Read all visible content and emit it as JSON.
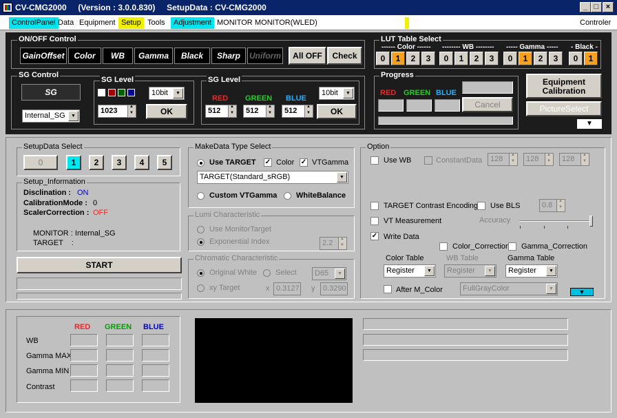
{
  "window": {
    "title": "CV-CMG2000     (Version : 3.0.0.830)     SetupData : CV-CMG2000"
  },
  "menu": {
    "items": [
      "ControlPanel",
      "Data",
      "Equipment",
      "Setup",
      "Tools",
      "Adjustment"
    ],
    "monitor_label": "MONITOR",
    "monitor_value": "MONITOR(WLED)",
    "controller": "Controler"
  },
  "onoff": {
    "title": "ON/OFF Control",
    "buttons": [
      "GainOffset",
      "Color",
      "WB",
      "Gamma",
      "Black",
      "Sharp",
      "Uniform"
    ],
    "all_off": "All OFF",
    "check": "Check"
  },
  "lut": {
    "title": "LUT Table Select",
    "color_hdr": "------ Color ------",
    "wb_hdr": "-------- WB --------",
    "gamma_hdr": "----- Gamma -----",
    "black_hdr": "- Black -",
    "color": [
      "0",
      "1",
      "2",
      "3"
    ],
    "wb": [
      "0",
      "1",
      "2",
      "3"
    ],
    "gamma": [
      "0",
      "1",
      "2",
      "3"
    ],
    "black": [
      "0",
      "1"
    ]
  },
  "sg": {
    "title": "SG Control",
    "button": "SG",
    "source": "Internal_SG",
    "level1": {
      "title": "SG Level",
      "bits": "10bit",
      "value": "1023",
      "ok": "OK"
    },
    "level2": {
      "title": "SG Level",
      "red": "RED",
      "green": "GREEN",
      "blue": "BLUE",
      "r": "512",
      "g": "512",
      "b": "512",
      "bits": "10bit",
      "ok": "OK"
    }
  },
  "progress": {
    "title": "Progress",
    "red": "RED",
    "green": "GREEN",
    "blue": "BLUE",
    "cancel": "Cancel"
  },
  "equip": {
    "calibration": "Equipment Calibration",
    "picture": "PictureSelect"
  },
  "setup_select": {
    "title": "SetupData Select",
    "buttons": [
      "0",
      "1",
      "2",
      "3",
      "4",
      "5"
    ]
  },
  "setup_info": {
    "title": "Setup_Information",
    "disc_label": "Disclination :",
    "disc_val": "ON",
    "cal_label": "CalibrationMode :",
    "cal_val": "0",
    "scaler_label": "ScalerCorrection :",
    "scaler_val": "OFF",
    "monitor_line": "MONITOR : Internal_SG",
    "target_line": "TARGET    :"
  },
  "start": "START",
  "makedata": {
    "title": "MakeData Type Select",
    "use_target": "Use TARGET",
    "color": "Color",
    "vtgamma": "VTGamma",
    "target_sel": "TARGET(Standard_sRGB)",
    "custom": "Custom VTGamma",
    "wb": "WhiteBalance"
  },
  "lumi": {
    "title": "Lumi Characteristic",
    "use_monitor": "Use MonitorTarget",
    "exp": "Exponential Index",
    "exp_val": "2.2"
  },
  "chrom": {
    "title": "Chromatic Characteristic",
    "orig": "Original White",
    "select": "Select",
    "d65": "D65",
    "xy": "xy Target",
    "x_label": "x",
    "x_val": "0.3127",
    "y_label": "y",
    "y_val": "0.3290"
  },
  "option": {
    "title": "Option",
    "use_wb": "Use WB",
    "const": "ConstantData",
    "c1": "128",
    "c2": "128",
    "c3": "128",
    "target_contrast": "TARGET Contrast Encoding",
    "use_bls": "Use BLS",
    "bls_val": "0.8",
    "vt_meas": "VT Measurement",
    "accuracy": "Accuracy",
    "write": "Write Data",
    "color_corr": "Color_Correction",
    "gamma_corr": "Gamma_Correction",
    "color_table": "Color Table",
    "wb_table": "WB Table",
    "gamma_table": "Gamma Table",
    "ct_val": "Register",
    "wb_val": "Register",
    "gt_val": "Register",
    "after": "After M_Color",
    "full": "FullGrayColor"
  },
  "results": {
    "red": "RED",
    "green": "GREEN",
    "blue": "BLUE",
    "rows": [
      "WB",
      "Gamma MAX",
      "Gamma MIN",
      "Contrast"
    ]
  }
}
